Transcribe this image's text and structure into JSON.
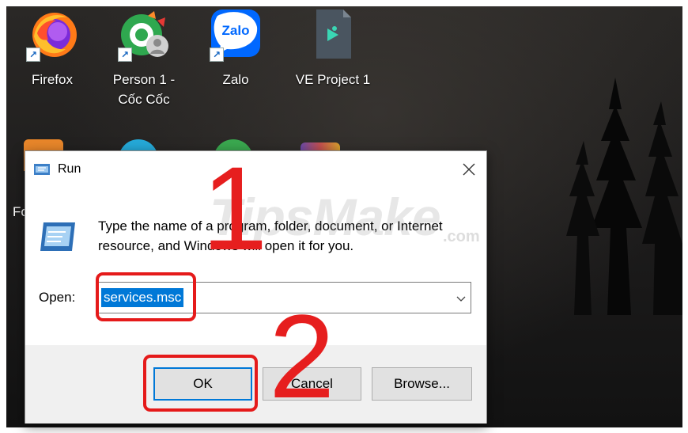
{
  "desktop": {
    "icons": [
      {
        "label": "Firefox"
      },
      {
        "label": "Person 1 - Cốc Cốc"
      },
      {
        "label": "Zalo",
        "icon_text": "Zalo"
      },
      {
        "label": "VE Project 1"
      }
    ],
    "partial_label": "Fo"
  },
  "run_dialog": {
    "title": "Run",
    "description": "Type the name of a program, folder, document, or Internet resource, and Windows will open it for you.",
    "open_label": "Open:",
    "input_value": "services.msc",
    "buttons": {
      "ok": "OK",
      "cancel": "Cancel",
      "browse": "Browse..."
    }
  },
  "annotations": {
    "step1": "1",
    "step2": "2",
    "watermark": "TipsMake",
    "watermark_suffix": ".com"
  },
  "colors": {
    "accent": "#0078d7",
    "highlight": "#e51a1a"
  }
}
